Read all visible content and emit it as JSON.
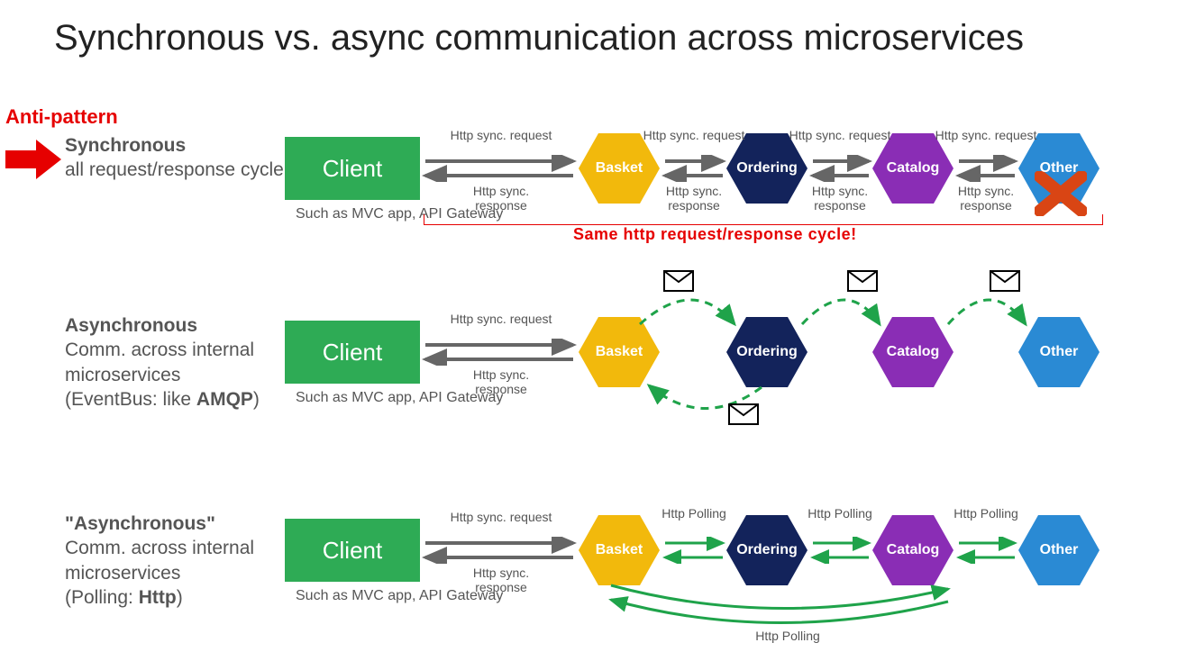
{
  "title": "Synchronous vs. async communication across microservices",
  "antipattern": "Anti-pattern",
  "same_cycle": "Same http request/response cycle!",
  "sections": {
    "sync": {
      "heading": "Synchronous",
      "sub": "all request/response cycle"
    },
    "async": {
      "heading": "Asynchronous",
      "sub1": "Comm. across internal microservices",
      "sub2": "(EventBus: like ",
      "sub2b": "AMQP",
      "sub2c": ")"
    },
    "poll": {
      "heading": "\"Asynchronous\"",
      "sub1": "Comm. across internal microservices",
      "sub2": "(Polling: ",
      "sub2b": "Http",
      "sub2c": ")"
    }
  },
  "nodes": {
    "client": "Client",
    "basket": "Basket",
    "ordering": "Ordering",
    "catalog": "Catalog",
    "other": "Other"
  },
  "client_caption": "Such as MVC app, API Gateway",
  "labels": {
    "req": "Http sync. request",
    "resp": "Http sync. response",
    "poll": "Http Polling"
  },
  "colors": {
    "green": "#2eab55",
    "yellow": "#f2b90c",
    "navy": "#13235b",
    "purple": "#8a2db5",
    "blue": "#2a8ad4",
    "red": "#e60000",
    "arrow": "#666",
    "greenline": "#1fa34a"
  }
}
